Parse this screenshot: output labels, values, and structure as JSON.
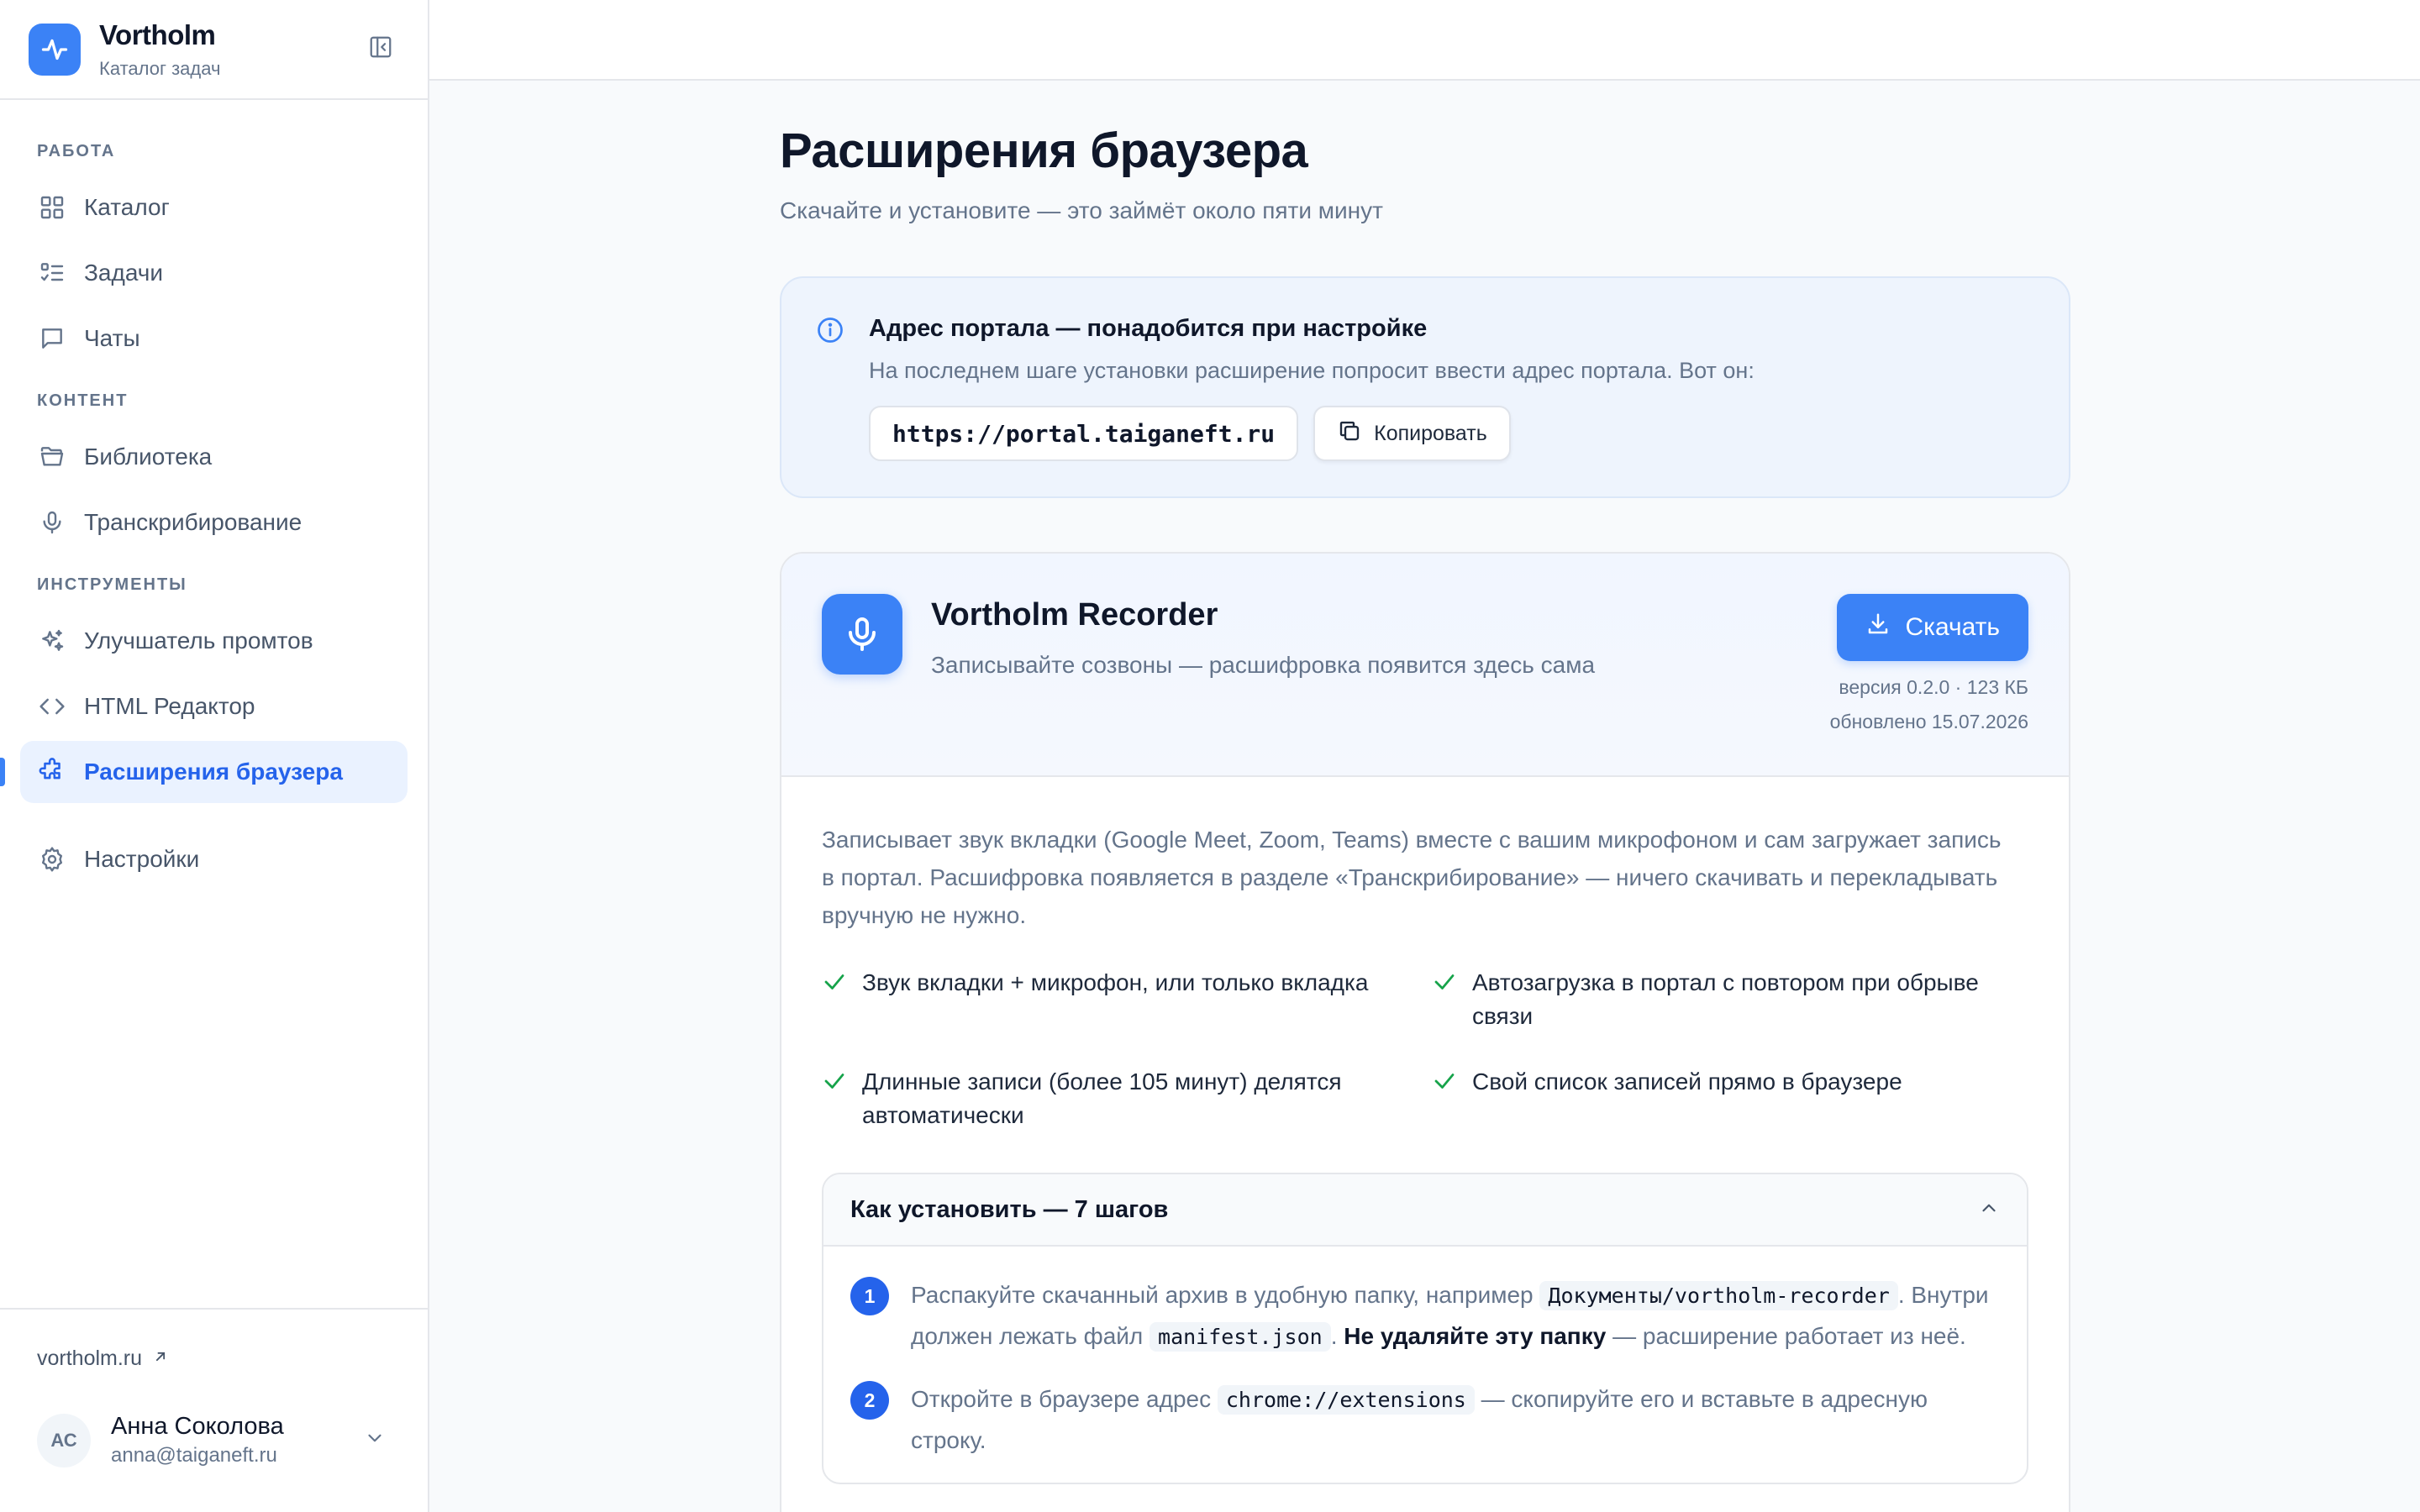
{
  "brand": {
    "name": "Vortholm",
    "subtitle": "Каталог задач"
  },
  "sidebar": {
    "sections": [
      {
        "title": "РАБОТА",
        "items": [
          {
            "label": "Каталог",
            "icon": "grid-icon"
          },
          {
            "label": "Задачи",
            "icon": "list-check-icon"
          },
          {
            "label": "Чаты",
            "icon": "chat-icon"
          }
        ]
      },
      {
        "title": "КОНТЕНТ",
        "items": [
          {
            "label": "Библиотека",
            "icon": "folder-icon"
          },
          {
            "label": "Транскрибирование",
            "icon": "microphone-icon"
          }
        ]
      },
      {
        "title": "ИНСТРУМЕНТЫ",
        "items": [
          {
            "label": "Улучшатель промтов",
            "icon": "sparkles-icon"
          },
          {
            "label": "HTML Редактор",
            "icon": "code-icon"
          },
          {
            "label": "Расширения браузера",
            "icon": "puzzle-icon",
            "active": true
          }
        ]
      }
    ],
    "settings_label": "Настройки",
    "site_link": "vortholm.ru",
    "user": {
      "initials": "АС",
      "name": "Анна Соколова",
      "email": "anna@taiganeft.ru"
    }
  },
  "page": {
    "title": "Расширения браузера",
    "subtitle": "Скачайте и установите — это займёт около пяти минут"
  },
  "portal": {
    "title": "Адрес портала — понадобится при настройке",
    "description": "На последнем шаге установки расширение попросит ввести адрес портала. Вот он:",
    "url": "https://portal.taiganeft.ru",
    "copy_label": "Копировать"
  },
  "extension": {
    "name": "Vortholm Recorder",
    "tagline": "Записывайте созвоны — расшифровка появится здесь сама",
    "download_label": "Скачать",
    "version": "версия 0.2.0 · 123 КБ",
    "updated": "обновлено 15.07.2026",
    "description": "Записывает звук вкладки (Google Meet, Zoom, Teams) вместе с вашим микрофоном и сам загружает запись в портал. Расшифровка появляется в разделе «Транскрибирование» — ничего скачивать и перекладывать вручную не нужно.",
    "features": [
      "Звук вкладки + микрофон, или только вкладка",
      "Автозагрузка в портал с повтором при обрыве связи",
      "Длинные записи (более 105 минут) делятся автоматически",
      "Свой список записей прямо в браузере"
    ],
    "install": {
      "title": "Как установить — 7 шагов",
      "steps": [
        {
          "num": "1",
          "t1": "Распакуйте скачанный архив в удобную папку, например ",
          "c1": "Документы/vortholm-recorder",
          "t2": ". Внутри должен лежать файл ",
          "c2": "manifest.json",
          "t3": ". ",
          "b1": "Не удаляйте эту папку",
          "t4": " — расширение работает из неё."
        },
        {
          "num": "2",
          "t1": "Откройте в браузере адрес ",
          "c1": "chrome://extensions",
          "t2": " — скопируйте его и вставьте в адресную строку."
        }
      ]
    }
  },
  "colors": {
    "accent": "#3b82f6",
    "accent_dark": "#2563eb",
    "check": "#16a34a"
  }
}
